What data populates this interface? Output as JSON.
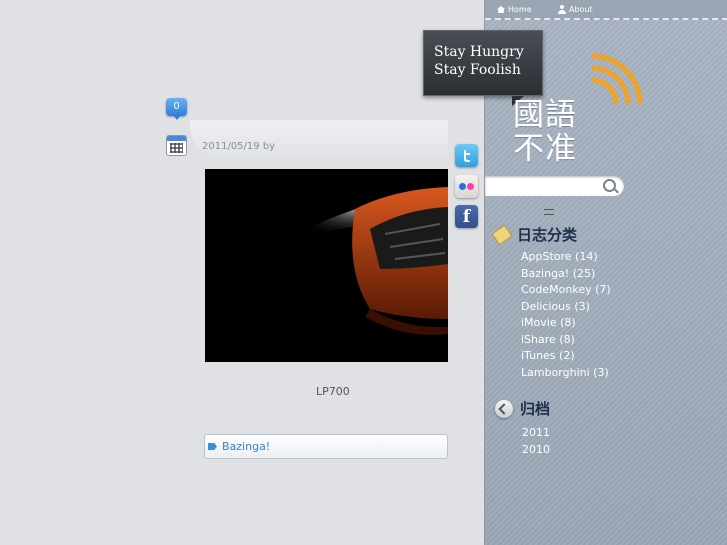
{
  "post": {
    "comment_count": "0",
    "date_line": "2011/05/19 by",
    "caption": "LP700",
    "tag": "Bazinga!"
  },
  "share": {
    "icons": [
      "twitter-icon",
      "flickr-icon",
      "facebook-icon"
    ],
    "facebook_glyph": "f"
  },
  "sidebar": {
    "nav": {
      "home": "Home",
      "about": "About"
    },
    "slogan_line1": "Stay Hungry",
    "slogan_line2": "Stay Foolish",
    "brand_line1": "國語",
    "brand_line2": "不准",
    "categories_title": "日志分类",
    "categories": [
      "AppStore (14)",
      "Bazinga! (25)",
      "CodeMonkey (7)",
      "Delicious (3)",
      "iMovie (8)",
      "iShare (8)",
      "iTunes (2)",
      "Lamborghini (3)"
    ],
    "archive_title": "归档",
    "archives": [
      "2011",
      "2010"
    ]
  },
  "colors": {
    "accent": "#3b7fd0",
    "sidebar_bg": "#a4afbe",
    "rss": "#f0a326",
    "heading": "#1e2f4a"
  }
}
